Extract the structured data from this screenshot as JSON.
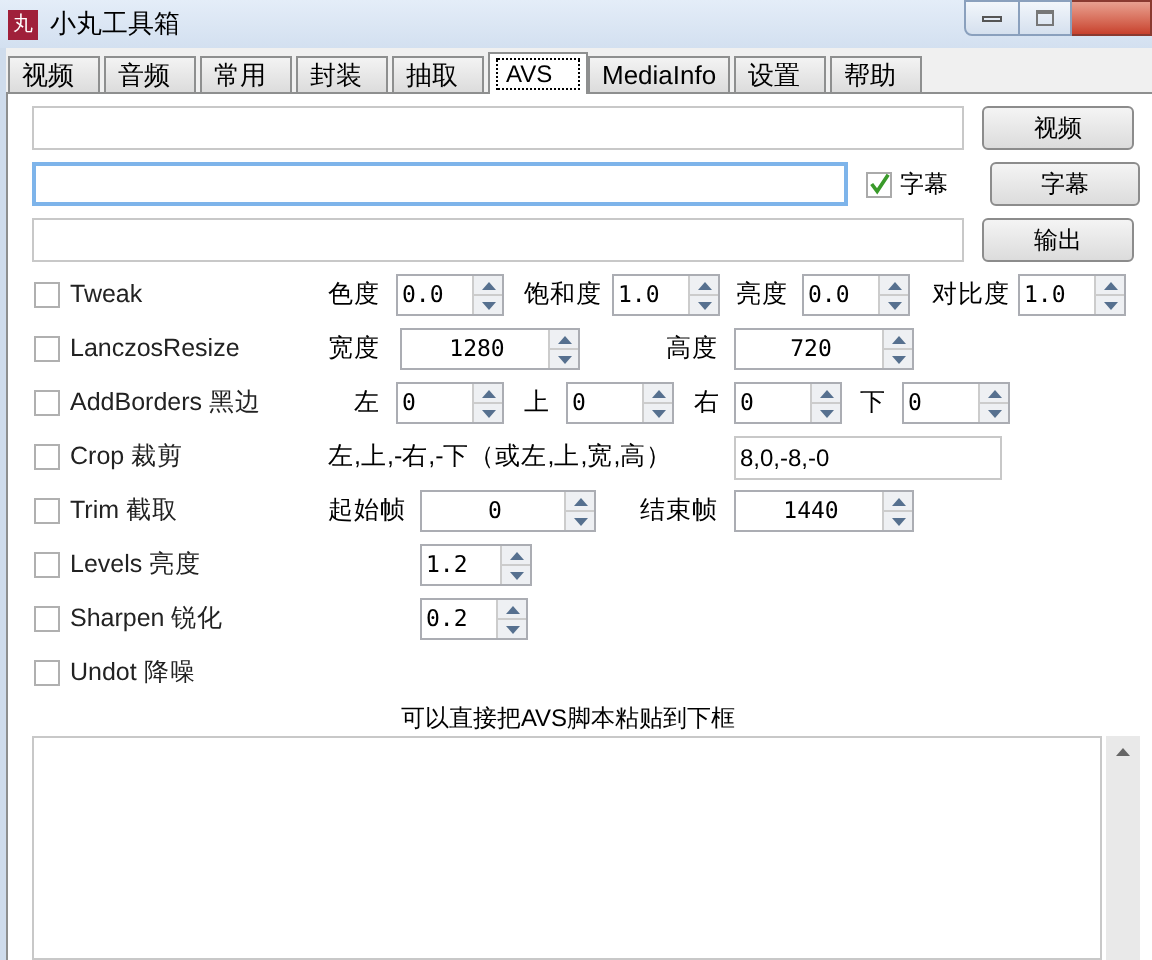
{
  "window": {
    "icon_text": "丸",
    "title": "小丸工具箱"
  },
  "tabs": [
    {
      "label": "视频",
      "selected": false
    },
    {
      "label": "音频",
      "selected": false
    },
    {
      "label": "常用",
      "selected": false
    },
    {
      "label": "封装",
      "selected": false
    },
    {
      "label": "抽取",
      "selected": false
    },
    {
      "label": "AVS",
      "selected": true
    },
    {
      "label": "MediaInfo",
      "selected": false
    },
    {
      "label": "设置",
      "selected": false
    },
    {
      "label": "帮助",
      "selected": false
    }
  ],
  "file_rows": [
    {
      "focused": false,
      "button": "视频"
    },
    {
      "focused": true,
      "checkbox": {
        "label": "字幕",
        "checked": true
      },
      "button": "字幕"
    },
    {
      "focused": false,
      "button": "输出"
    }
  ],
  "filters": [
    {
      "label": "Tweak",
      "checked": false,
      "params": [
        {
          "kind": "spin",
          "label": "色度",
          "value": "0.0"
        },
        {
          "kind": "spin",
          "label": "饱和度",
          "value": "1.0"
        },
        {
          "kind": "spin",
          "label": "亮度",
          "value": "0.0"
        },
        {
          "kind": "spin",
          "label": "对比度",
          "value": "1.0"
        }
      ]
    },
    {
      "label": "LanczosResize",
      "checked": false,
      "params": [
        {
          "kind": "spin",
          "label": "宽度",
          "value": "1280"
        },
        {
          "kind": "spin",
          "label": "高度",
          "value": "720"
        }
      ]
    },
    {
      "label": "AddBorders 黑边",
      "checked": false,
      "params": [
        {
          "kind": "spin",
          "label": "左",
          "value": "0"
        },
        {
          "kind": "spin",
          "label": "上",
          "value": "0"
        },
        {
          "kind": "spin",
          "label": "右",
          "value": "0"
        },
        {
          "kind": "spin",
          "label": "下",
          "value": "0"
        }
      ]
    },
    {
      "label": "Crop 裁剪",
      "checked": false,
      "params": [
        {
          "kind": "field",
          "label": "左,上,-右,-下（或左,上,宽,高）",
          "value": "8,0,-8,-0"
        }
      ]
    },
    {
      "label": "Trim 截取",
      "checked": false,
      "params": [
        {
          "kind": "spin",
          "label": "起始帧",
          "value": "0"
        },
        {
          "kind": "spin",
          "label": "结束帧",
          "value": "1440"
        }
      ]
    },
    {
      "label": "Levels 亮度",
      "checked": false,
      "params": [
        {
          "kind": "spin",
          "value": "1.2"
        }
      ]
    },
    {
      "label": "Sharpen 锐化",
      "checked": false,
      "params": [
        {
          "kind": "spin",
          "value": "0.2"
        }
      ]
    },
    {
      "label": "Undot 降噪",
      "checked": false
    }
  ],
  "script_hint": "可以直接把AVS脚本粘贴到下框"
}
